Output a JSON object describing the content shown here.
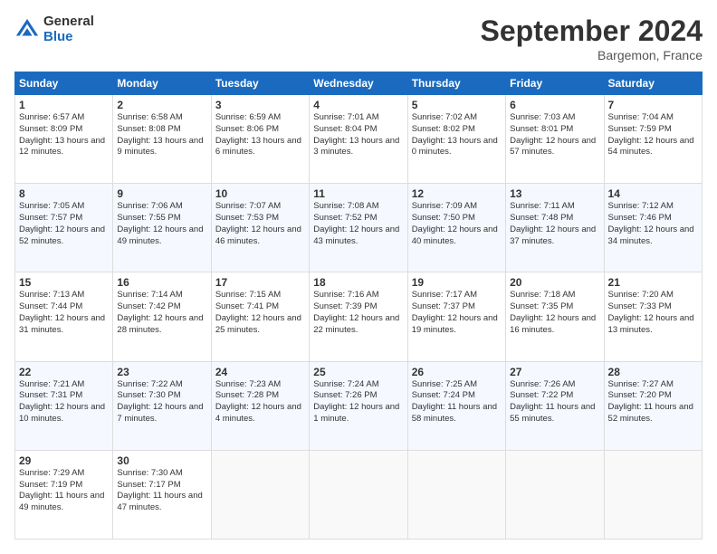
{
  "logo": {
    "general": "General",
    "blue": "Blue"
  },
  "header": {
    "month": "September 2024",
    "location": "Bargemon, France"
  },
  "weekdays": [
    "Sunday",
    "Monday",
    "Tuesday",
    "Wednesday",
    "Thursday",
    "Friday",
    "Saturday"
  ],
  "weeks": [
    [
      {
        "day": 1,
        "info": "Sunrise: 6:57 AM\nSunset: 8:09 PM\nDaylight: 13 hours and 12 minutes."
      },
      {
        "day": 2,
        "info": "Sunrise: 6:58 AM\nSunset: 8:08 PM\nDaylight: 13 hours and 9 minutes."
      },
      {
        "day": 3,
        "info": "Sunrise: 6:59 AM\nSunset: 8:06 PM\nDaylight: 13 hours and 6 minutes."
      },
      {
        "day": 4,
        "info": "Sunrise: 7:01 AM\nSunset: 8:04 PM\nDaylight: 13 hours and 3 minutes."
      },
      {
        "day": 5,
        "info": "Sunrise: 7:02 AM\nSunset: 8:02 PM\nDaylight: 13 hours and 0 minutes."
      },
      {
        "day": 6,
        "info": "Sunrise: 7:03 AM\nSunset: 8:01 PM\nDaylight: 12 hours and 57 minutes."
      },
      {
        "day": 7,
        "info": "Sunrise: 7:04 AM\nSunset: 7:59 PM\nDaylight: 12 hours and 54 minutes."
      }
    ],
    [
      {
        "day": 8,
        "info": "Sunrise: 7:05 AM\nSunset: 7:57 PM\nDaylight: 12 hours and 52 minutes."
      },
      {
        "day": 9,
        "info": "Sunrise: 7:06 AM\nSunset: 7:55 PM\nDaylight: 12 hours and 49 minutes."
      },
      {
        "day": 10,
        "info": "Sunrise: 7:07 AM\nSunset: 7:53 PM\nDaylight: 12 hours and 46 minutes."
      },
      {
        "day": 11,
        "info": "Sunrise: 7:08 AM\nSunset: 7:52 PM\nDaylight: 12 hours and 43 minutes."
      },
      {
        "day": 12,
        "info": "Sunrise: 7:09 AM\nSunset: 7:50 PM\nDaylight: 12 hours and 40 minutes."
      },
      {
        "day": 13,
        "info": "Sunrise: 7:11 AM\nSunset: 7:48 PM\nDaylight: 12 hours and 37 minutes."
      },
      {
        "day": 14,
        "info": "Sunrise: 7:12 AM\nSunset: 7:46 PM\nDaylight: 12 hours and 34 minutes."
      }
    ],
    [
      {
        "day": 15,
        "info": "Sunrise: 7:13 AM\nSunset: 7:44 PM\nDaylight: 12 hours and 31 minutes."
      },
      {
        "day": 16,
        "info": "Sunrise: 7:14 AM\nSunset: 7:42 PM\nDaylight: 12 hours and 28 minutes."
      },
      {
        "day": 17,
        "info": "Sunrise: 7:15 AM\nSunset: 7:41 PM\nDaylight: 12 hours and 25 minutes."
      },
      {
        "day": 18,
        "info": "Sunrise: 7:16 AM\nSunset: 7:39 PM\nDaylight: 12 hours and 22 minutes."
      },
      {
        "day": 19,
        "info": "Sunrise: 7:17 AM\nSunset: 7:37 PM\nDaylight: 12 hours and 19 minutes."
      },
      {
        "day": 20,
        "info": "Sunrise: 7:18 AM\nSunset: 7:35 PM\nDaylight: 12 hours and 16 minutes."
      },
      {
        "day": 21,
        "info": "Sunrise: 7:20 AM\nSunset: 7:33 PM\nDaylight: 12 hours and 13 minutes."
      }
    ],
    [
      {
        "day": 22,
        "info": "Sunrise: 7:21 AM\nSunset: 7:31 PM\nDaylight: 12 hours and 10 minutes."
      },
      {
        "day": 23,
        "info": "Sunrise: 7:22 AM\nSunset: 7:30 PM\nDaylight: 12 hours and 7 minutes."
      },
      {
        "day": 24,
        "info": "Sunrise: 7:23 AM\nSunset: 7:28 PM\nDaylight: 12 hours and 4 minutes."
      },
      {
        "day": 25,
        "info": "Sunrise: 7:24 AM\nSunset: 7:26 PM\nDaylight: 12 hours and 1 minute."
      },
      {
        "day": 26,
        "info": "Sunrise: 7:25 AM\nSunset: 7:24 PM\nDaylight: 11 hours and 58 minutes."
      },
      {
        "day": 27,
        "info": "Sunrise: 7:26 AM\nSunset: 7:22 PM\nDaylight: 11 hours and 55 minutes."
      },
      {
        "day": 28,
        "info": "Sunrise: 7:27 AM\nSunset: 7:20 PM\nDaylight: 11 hours and 52 minutes."
      }
    ],
    [
      {
        "day": 29,
        "info": "Sunrise: 7:29 AM\nSunset: 7:19 PM\nDaylight: 11 hours and 49 minutes."
      },
      {
        "day": 30,
        "info": "Sunrise: 7:30 AM\nSunset: 7:17 PM\nDaylight: 11 hours and 47 minutes."
      },
      null,
      null,
      null,
      null,
      null
    ]
  ]
}
